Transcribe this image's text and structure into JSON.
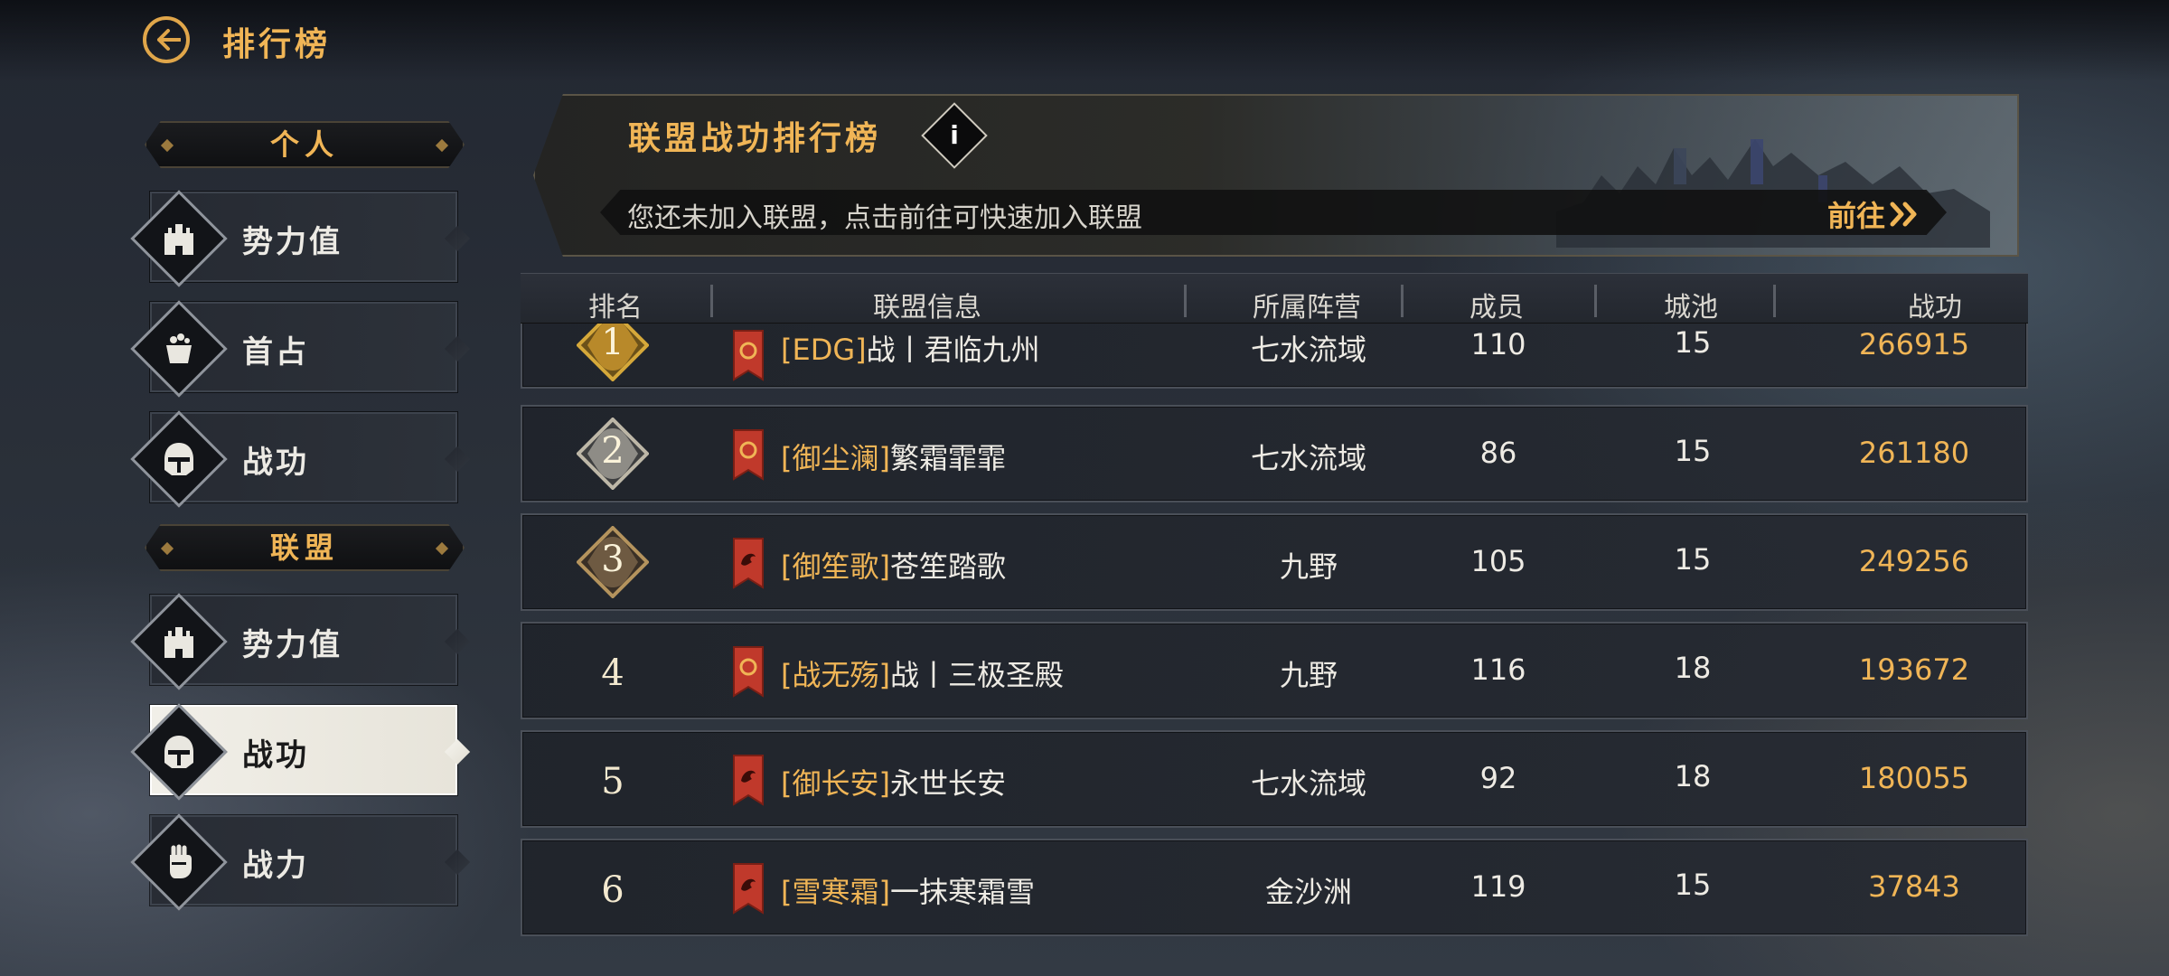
{
  "header": {
    "title": "排行榜",
    "back_icon": "back-arrow-icon"
  },
  "sidebar": {
    "personal_label": "个人",
    "alliance_label": "联盟",
    "personal_items": [
      {
        "label": "势力值",
        "icon": "castle-icon"
      },
      {
        "label": "首占",
        "icon": "treasure-pot-icon"
      },
      {
        "label": "战功",
        "icon": "helmet-icon"
      }
    ],
    "alliance_items": [
      {
        "label": "势力值",
        "icon": "castle-icon"
      },
      {
        "label": "战功",
        "icon": "helmet-icon",
        "active": true
      },
      {
        "label": "战力",
        "icon": "fist-icon"
      }
    ]
  },
  "banner": {
    "title": "联盟战功排行榜",
    "info_icon": "info-icon",
    "notice": "您还未加入联盟，点击前往可快速加入联盟",
    "goto_label": "前往"
  },
  "table": {
    "headers": [
      "排名",
      "联盟信息",
      "所属阵营",
      "成员",
      "城池",
      "战功"
    ],
    "rows": [
      {
        "rank": "1",
        "tag": "[EDG]",
        "name": "战丨君临九州",
        "faction": "七水流域",
        "members": "110",
        "cities": "15",
        "merit": "266915",
        "medal": "gold",
        "flag": "ring"
      },
      {
        "rank": "2",
        "tag": "[御尘澜]",
        "name": "繁霜霏霏",
        "faction": "七水流域",
        "members": "86",
        "cities": "15",
        "merit": "261180",
        "medal": "silver",
        "flag": "ring"
      },
      {
        "rank": "3",
        "tag": "[御笙歌]",
        "name": "苍笙踏歌",
        "faction": "九野",
        "members": "105",
        "cities": "15",
        "merit": "249256",
        "medal": "bronze",
        "flag": "dragon"
      },
      {
        "rank": "4",
        "tag": "[战无殇]",
        "name": "战丨三极圣殿",
        "faction": "九野",
        "members": "116",
        "cities": "18",
        "merit": "193672",
        "medal": "none",
        "flag": "ring"
      },
      {
        "rank": "5",
        "tag": "[御长安]",
        "name": "永世长安",
        "faction": "七水流域",
        "members": "92",
        "cities": "18",
        "merit": "180055",
        "medal": "none",
        "flag": "dragon"
      },
      {
        "rank": "6",
        "tag": "[雪寒霜]",
        "name": "一抹寒霜雪",
        "faction": "金沙洲",
        "members": "119",
        "cities": "15",
        "merit": "37843",
        "medal": "none",
        "flag": "dragon"
      }
    ]
  },
  "colors": {
    "accent_gold": "#f0b556",
    "flag_red": "#c0392b",
    "panel_dark": "#23272e"
  }
}
